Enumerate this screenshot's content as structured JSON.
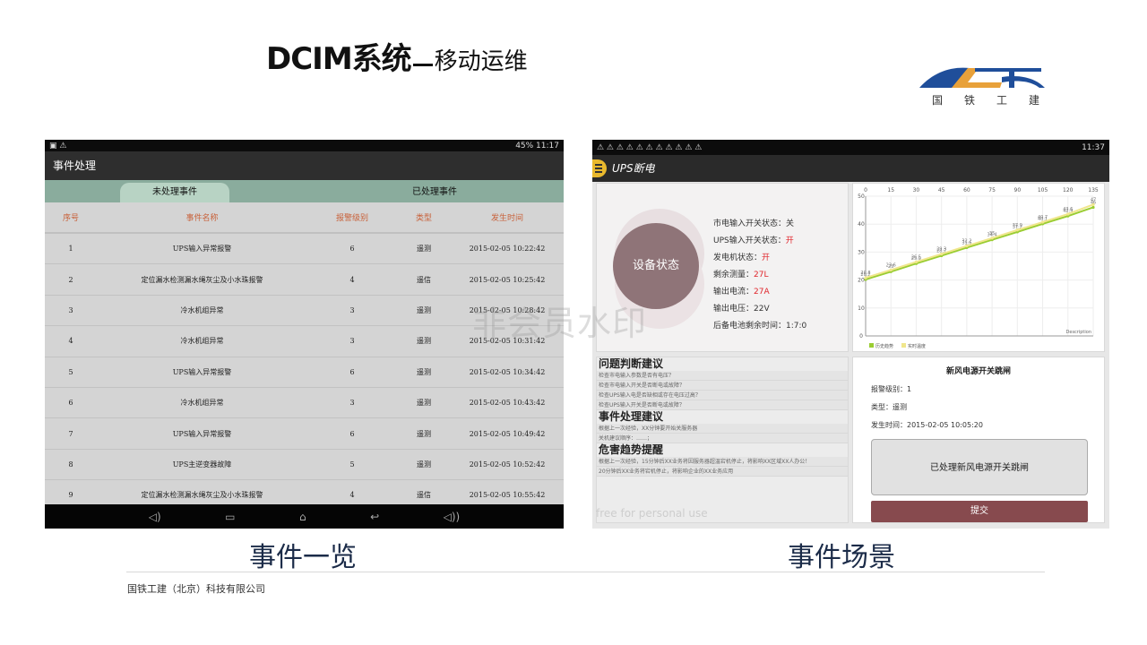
{
  "slide": {
    "title_main": "DCIM系统",
    "title_sub": "移动运维",
    "logo_text": [
      "国",
      "铁",
      "工",
      "建"
    ],
    "caption_left": "事件一览",
    "caption_right": "事件场景",
    "footer": "国铁工建（北京）科技有限公司",
    "watermark": "非会员水印"
  },
  "left_phone": {
    "status_time": "45% 11:17",
    "app_title": "事件处理",
    "tabs": [
      "未处理事件",
      "已处理事件"
    ],
    "columns": [
      "序号",
      "事件名称",
      "报警级别",
      "类型",
      "发生时间"
    ],
    "rows": [
      {
        "no": "1",
        "name": "UPS输入异常报警",
        "level": "6",
        "type": "遥测",
        "time": "2015-02-05 10:22:42"
      },
      {
        "no": "2",
        "name": "定位漏水检测漏水绳灰尘及小水珠报警",
        "level": "4",
        "type": "遥信",
        "time": "2015-02-05 10:25:42"
      },
      {
        "no": "3",
        "name": "冷水机组异常",
        "level": "3",
        "type": "遥测",
        "time": "2015-02-05 10:28:42"
      },
      {
        "no": "4",
        "name": "冷水机组异常",
        "level": "3",
        "type": "遥测",
        "time": "2015-02-05 10:31:42"
      },
      {
        "no": "5",
        "name": "UPS输入异常报警",
        "level": "6",
        "type": "遥测",
        "time": "2015-02-05 10:34:42"
      },
      {
        "no": "6",
        "name": "冷水机组异常",
        "level": "3",
        "type": "遥测",
        "time": "2015-02-05 10:43:42"
      },
      {
        "no": "7",
        "name": "UPS输入异常报警",
        "level": "6",
        "type": "遥测",
        "time": "2015-02-05 10:49:42"
      },
      {
        "no": "8",
        "name": "UPS主逆变器故障",
        "level": "5",
        "type": "遥测",
        "time": "2015-02-05 10:52:42"
      },
      {
        "no": "9",
        "name": "定位漏水检测漏水绳灰尘及小水珠报警",
        "level": "4",
        "type": "遥信",
        "time": "2015-02-05 10:55:42"
      }
    ]
  },
  "right_phone": {
    "status_time": "11:37",
    "app_title": "UPS断电",
    "device_status_label": "设备状态",
    "status_items": [
      {
        "label": "市电输入开关状态：",
        "value": "关",
        "alert": false
      },
      {
        "label": "UPS输入开关状态：",
        "value": "开",
        "alert": true
      },
      {
        "label": "发电机状态：",
        "value": "开",
        "alert": true
      },
      {
        "label": "剩余测量：",
        "value": "27L",
        "alert": true
      },
      {
        "label": "输出电流：",
        "value": "27A",
        "alert": true
      },
      {
        "label": "输出电压：",
        "value": "22V",
        "alert": false
      },
      {
        "label": "后备电池剩余时间：",
        "value": "1:7:0",
        "alert": false
      }
    ],
    "advice": {
      "h1": "问题判断建议",
      "items1": [
        "检查市电输入参数是否有电压？",
        "检查市电输入开关是否断电或故障？",
        "检查UPS输入电是否缺相或存在电压过高？",
        "检查UPS输入开关是否断电或故障？"
      ],
      "h2": "事件处理建议",
      "items2": [
        "根据上一次经验，XX分钟要开始关服务器",
        "关机建议顺序：……；"
      ],
      "h3": "危害趋势提醒",
      "items3": [
        "根据上一次经验，15分钟后XX业务将因服务器超温宕机停止，将影响XX区域XX人办公！",
        "20分钟后XX业务将宕机停止，将影响企业的XX业务应用"
      ]
    },
    "event": {
      "title": "新风电源开关跳闸",
      "level": "报警级别：1",
      "type": "类型：遥测",
      "time": "发生时间：2015-02-05 10:05:20",
      "handled": "已处理新风电源开关跳闸",
      "submit": "提交"
    },
    "free_text": "free for personal use"
  },
  "chart_data": {
    "type": "line",
    "x_ticks": [
      "0",
      "15",
      "30",
      "45",
      "60",
      "75",
      "90",
      "105",
      "120",
      "135"
    ],
    "y_ticks": [
      "0",
      "10",
      "20",
      "30",
      "40",
      "50"
    ],
    "xlim": [
      0,
      135
    ],
    "ylim": [
      0,
      50
    ],
    "xlabel": "Description",
    "legend": [
      "历史趋势",
      "实时温度"
    ],
    "colors": {
      "history": "#9acd32",
      "realtime": "#f0e68c"
    },
    "series": [
      {
        "name": "历史趋势",
        "x": [
          0,
          15,
          30,
          45,
          60,
          75,
          90,
          105,
          120,
          135
        ],
        "values": [
          20.2,
          23,
          25.9,
          28.7,
          31.6,
          34.4,
          37.2,
          40.1,
          42.9,
          46
        ]
      },
      {
        "name": "实时温度",
        "x": [
          0,
          15,
          30,
          45,
          60,
          75,
          90,
          105,
          120,
          135
        ],
        "values": [
          20.8,
          23.6,
          26.5,
          29.3,
          32.2,
          35,
          37.9,
          40.7,
          43.6,
          47
        ]
      }
    ]
  }
}
